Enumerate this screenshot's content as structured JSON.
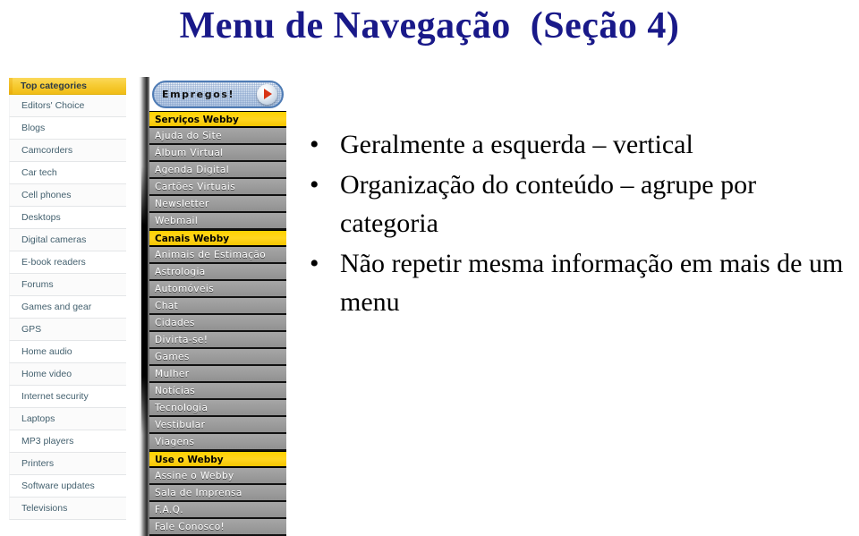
{
  "slide": {
    "title": "Menu de Navegação  (Seção 4)",
    "title_color": "#191989"
  },
  "left_panel": {
    "header": "Top categories",
    "header_bg": "#f7cc34",
    "items": [
      "Editors' Choice",
      "Blogs",
      "Camcorders",
      "Car tech",
      "Cell phones",
      "Desktops",
      "Digital cameras",
      "E-book readers",
      "Forums",
      "Games and gear",
      "GPS",
      "Home audio",
      "Home video",
      "Internet security",
      "Laptops",
      "MP3 players",
      "Printers",
      "Software updates",
      "Televisions"
    ]
  },
  "mid_panel": {
    "banner": {
      "label": "Empregos!",
      "arrow_icon": "play-arrow-icon",
      "arrow_color": "#d83416",
      "bg_color": "#c6d8ec"
    },
    "header_bg": "#ffd100",
    "item_bg": "#9b9b9b",
    "rows": [
      {
        "type": "header",
        "label": "Serviços Webby"
      },
      {
        "type": "item",
        "label": "Ajuda do Site"
      },
      {
        "type": "item",
        "label": "Álbum Virtual"
      },
      {
        "type": "item",
        "label": "Agenda Digital"
      },
      {
        "type": "item",
        "label": "Cartões Virtuais"
      },
      {
        "type": "item",
        "label": "Newsletter"
      },
      {
        "type": "item",
        "label": "Webmail"
      },
      {
        "type": "header",
        "label": "Canais Webby"
      },
      {
        "type": "item",
        "label": "Animais de Estimação"
      },
      {
        "type": "item",
        "label": "Astrologia"
      },
      {
        "type": "item",
        "label": "Automóveis"
      },
      {
        "type": "item",
        "label": "Chat"
      },
      {
        "type": "item",
        "label": "Cidades"
      },
      {
        "type": "item",
        "label": "Divirta-se!"
      },
      {
        "type": "item",
        "label": "Games"
      },
      {
        "type": "item",
        "label": "Mulher"
      },
      {
        "type": "item",
        "label": "Notícias"
      },
      {
        "type": "item",
        "label": "Tecnologia"
      },
      {
        "type": "item",
        "label": "Vestibular"
      },
      {
        "type": "item",
        "label": "Viagens"
      },
      {
        "type": "header",
        "label": "Use o Webby"
      },
      {
        "type": "item",
        "label": "Assine o Webby"
      },
      {
        "type": "item",
        "label": "Sala de Imprensa"
      },
      {
        "type": "item",
        "label": "F.A.Q."
      },
      {
        "type": "item",
        "label": "Fale Conosco!"
      }
    ]
  },
  "bullets": {
    "marker": "•",
    "items": [
      "Geralmente a esquerda – vertical",
      "Organização do conteúdo – agrupe por categoria",
      "Não repetir mesma informação em mais de um menu"
    ]
  }
}
